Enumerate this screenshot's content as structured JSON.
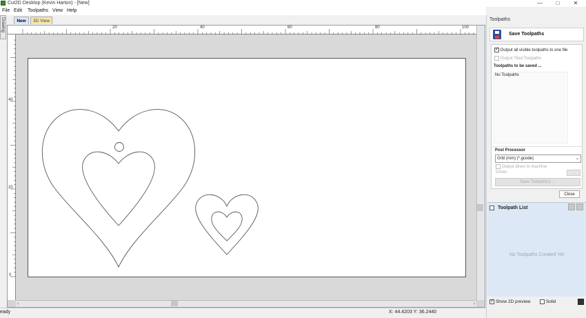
{
  "window": {
    "title": "Cut2D Desktop (Kevin Harton) - [New]",
    "minimize": "—",
    "restore": "□",
    "close": "✕"
  },
  "menu": [
    "File",
    "Edit",
    "Toolpaths",
    "View",
    "Help"
  ],
  "side_tab": "Drawing",
  "tabs": {
    "new": "New",
    "view3d": "3D View"
  },
  "ruler": {
    "top_labels": [
      "20",
      "40",
      "60",
      "80",
      "100"
    ],
    "left_labels": [
      "40",
      "20",
      "0"
    ]
  },
  "status": {
    "ready": "eady",
    "coords": "X: 44.4203 Y: 36.2440"
  },
  "panel": {
    "title": "Toolpaths",
    "save_title": "Save Toolpaths",
    "output_all_label": "Output all visible toolpaths to one file",
    "output_all_checked": true,
    "output_tiled_label": "Output Tiled Toolpaths",
    "to_be_saved_heading": "Toolpaths to be saved ...",
    "no_toolpaths": "No Toolpaths",
    "post_processor_heading": "Post Processor",
    "post_processor_value": "Grbl (mm) (*.gcode)",
    "output_direct_label": "Output direct to machine",
    "driver_label": "Driver:",
    "driver_button": "...",
    "save_button": "Save Toolpath(s) ...",
    "close_button": "Close",
    "toolpath_list_title": "Toolpath List",
    "no_toolpaths_created": "No Toolpaths Created Yet",
    "show_2d_label": "Show 2D preview",
    "show_2d_checked": true,
    "solid_label": "Solid",
    "solid_checked": false
  }
}
